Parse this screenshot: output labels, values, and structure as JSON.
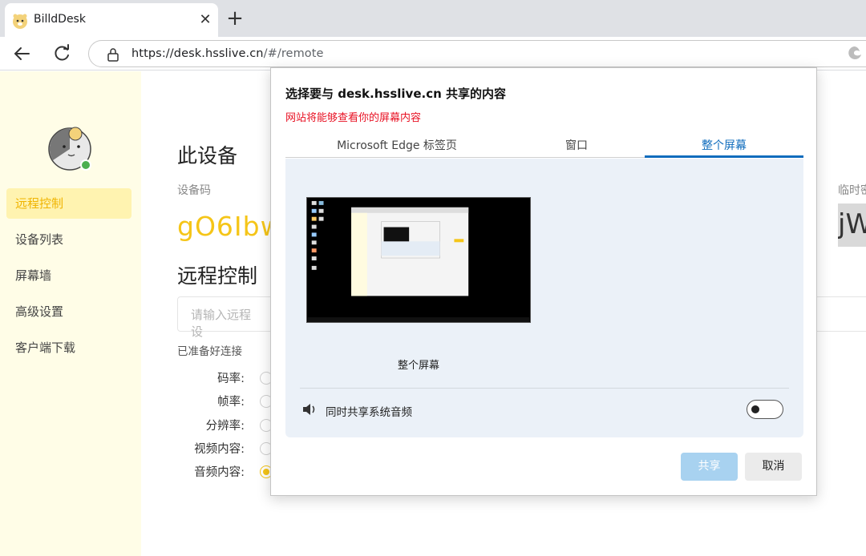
{
  "browser": {
    "tab_title": "BilldDesk",
    "url_host": "https://desk.hsslive.cn",
    "url_path": "/#/remote"
  },
  "sidebar": {
    "items": [
      {
        "label": "远程控制",
        "active": true
      },
      {
        "label": "设备列表"
      },
      {
        "label": "屏幕墙"
      },
      {
        "label": "高级设置"
      },
      {
        "label": "客户端下载"
      }
    ]
  },
  "main": {
    "device_heading": "此设备",
    "code_label": "设备码",
    "device_code": "gO6Ibw",
    "remote_heading": "远程控制",
    "remote_input_placeholder": "请输入远程设",
    "ready_text": "已准备好连接",
    "options": [
      {
        "label": "码率:"
      },
      {
        "label": "帧率:"
      },
      {
        "label": "分辨率:"
      },
      {
        "label": "视频内容:"
      },
      {
        "label": "音频内容:",
        "checked": true
      }
    ],
    "temp_label": "临时密",
    "temp_code": "jW"
  },
  "dialog": {
    "title": "选择要与 desk.hsslive.cn 共享的内容",
    "subtitle": "网站将能够查看你的屏幕内容",
    "tabs": [
      {
        "label": "Microsoft Edge 标签页"
      },
      {
        "label": "窗口"
      },
      {
        "label": "整个屏幕",
        "active": true
      }
    ],
    "thumbnail_caption": "整个屏幕",
    "audio_label": "同时共享系统音频",
    "audio_enabled": false,
    "share_label": "共享",
    "cancel_label": "取消"
  },
  "colors": {
    "accent_yellow": "#f5c518",
    "sidebar_bg": "#fffde7",
    "edge_blue": "#0f6cbd",
    "warning_red": "#e81123"
  }
}
